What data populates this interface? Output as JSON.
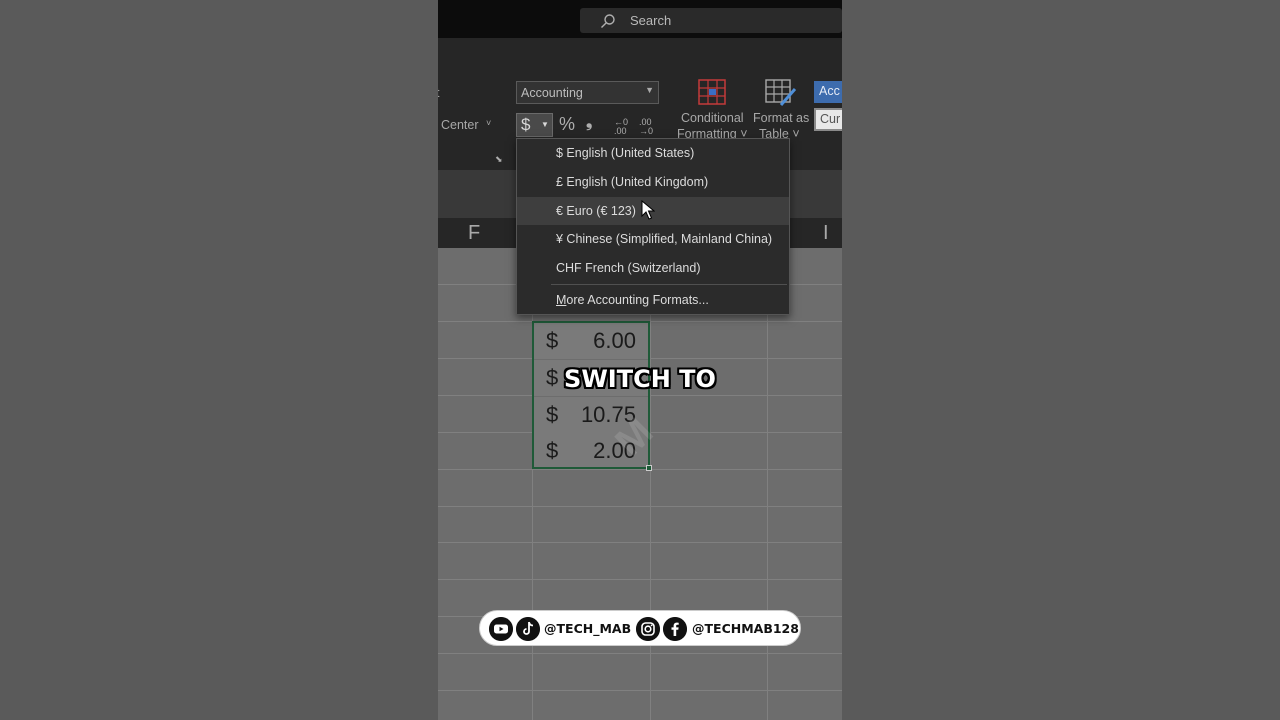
{
  "titlebar": {
    "search_label": "Search"
  },
  "ribbon": {
    "merge_center_label": "Center",
    "number_format_value": "Accounting",
    "currency_symbol": "$",
    "percent_symbol": "%",
    "comma_symbol": "❟",
    "increase_decimal": "←0 .00",
    "decrease_decimal": ".00 →0",
    "conditional_formatting_line1": "Conditional",
    "conditional_formatting_line2": "Formatting ˅",
    "format_as_table_line1": "Format as",
    "format_as_table_line2": "Table ˅",
    "cell_style_accounting": "Acc",
    "cell_style_currency": "Cur",
    "left_fragment": "t"
  },
  "columns": {
    "left": "F",
    "right": "I"
  },
  "cells": [
    {
      "symbol": "$",
      "amount": "6.00"
    },
    {
      "symbol": "$",
      "amount": ""
    },
    {
      "symbol": "$",
      "amount": "10.75"
    },
    {
      "symbol": "$",
      "amount": "2.00"
    }
  ],
  "dropdown": {
    "items": [
      "$ English (United States)",
      "£ English (United Kingdom)",
      "€ Euro (€ 123)",
      "¥ Chinese (Simplified, Mainland China)",
      "CHF French (Switzerland)"
    ],
    "more_first_letter": "M",
    "more_rest": "ore Accounting Formats..."
  },
  "overlay": {
    "caption": "SWITCH TO"
  },
  "social": {
    "handle1": "@TECH_MAB",
    "handle2": "@TECHMAB128"
  },
  "colors": {
    "accent_green": "#1f5a38",
    "accent_blue": "#3d6cae"
  }
}
